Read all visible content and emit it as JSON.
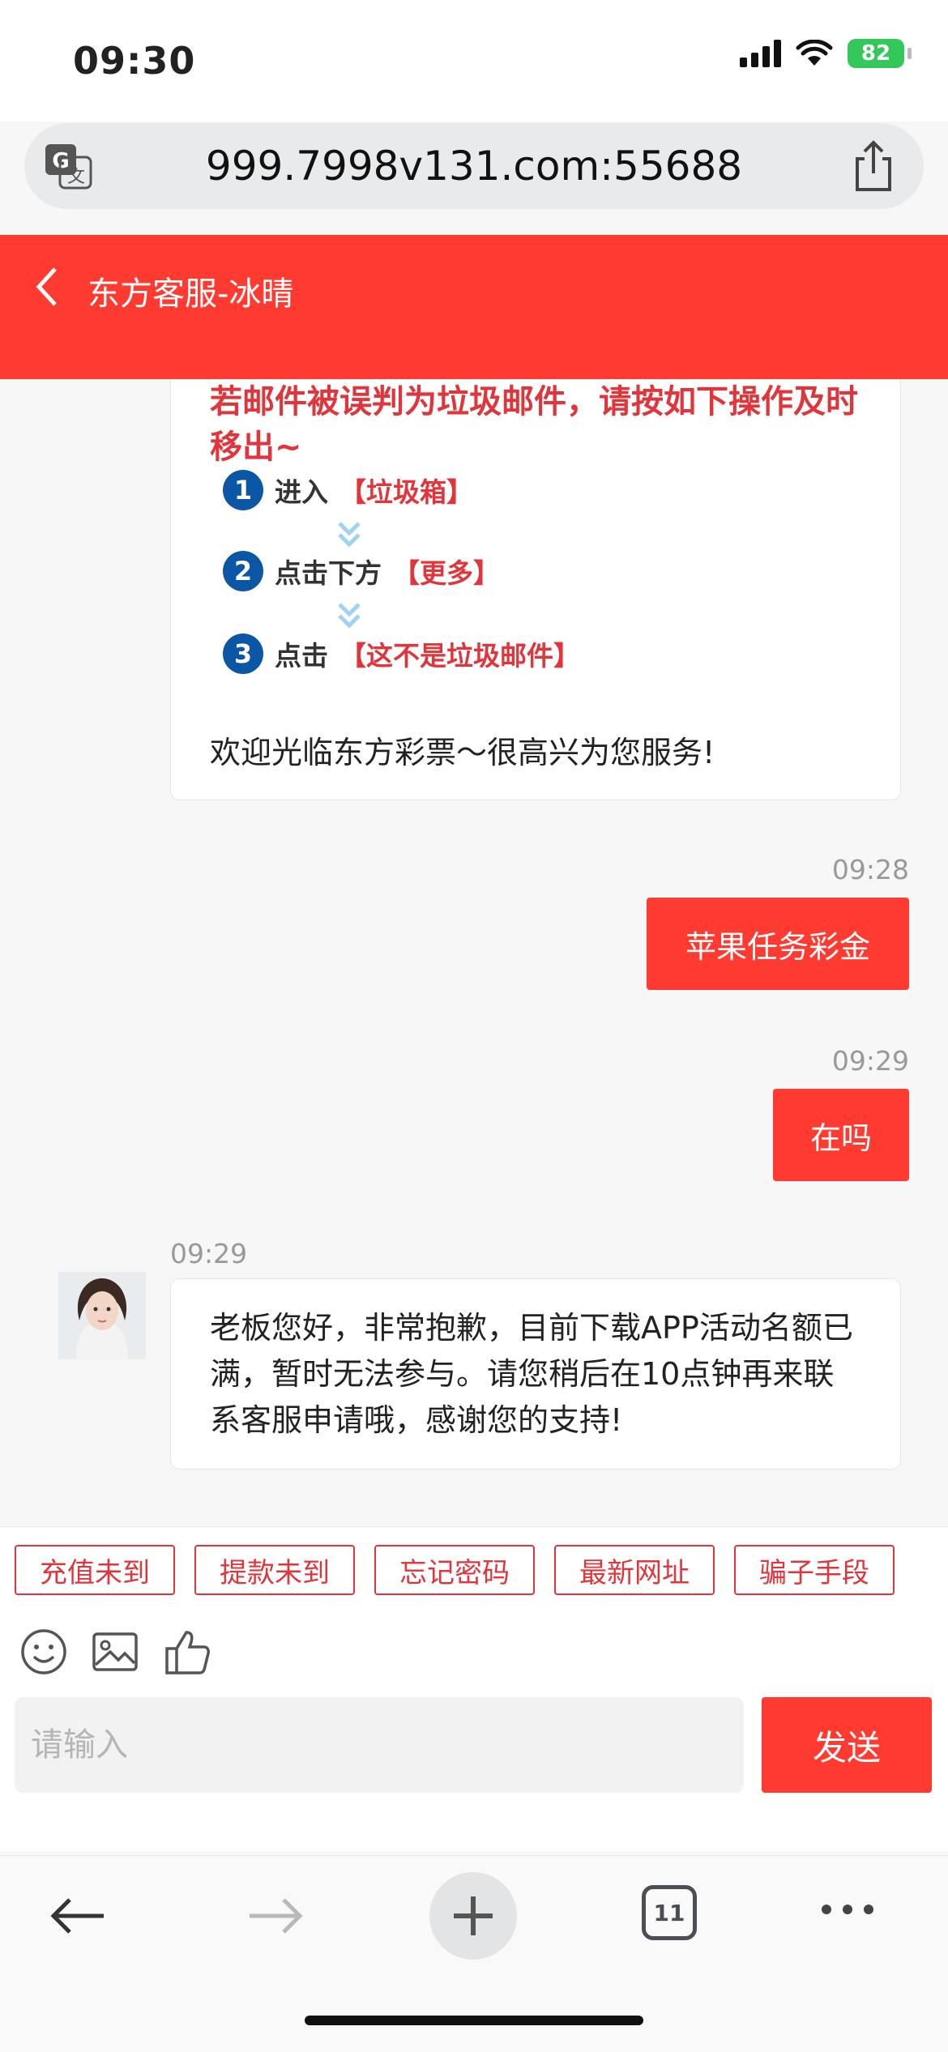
{
  "status_bar": {
    "time": "09:30",
    "battery": "82"
  },
  "browser": {
    "url": "999.7998v131.com:55688",
    "tabs_count": "11"
  },
  "header": {
    "title": "东方客服-冰晴"
  },
  "card": {
    "warning": "若邮件被误判为垃圾邮件，请按如下操作及时移出~",
    "steps": [
      {
        "num": "1",
        "prefix": "进入",
        "highlight": "【垃圾箱】"
      },
      {
        "num": "2",
        "prefix": "点击下方",
        "highlight": "【更多】"
      },
      {
        "num": "3",
        "prefix": "点击",
        "highlight": "【这不是垃圾邮件】"
      }
    ],
    "welcome": "欢迎光临东方彩票～很高兴为您服务!"
  },
  "messages": [
    {
      "time": "09:28",
      "text": "苹果任务彩金"
    },
    {
      "time": "09:29",
      "text": "在吗"
    },
    {
      "time": "09:29",
      "text": "老板您好，非常抱歉，目前下载APP活动名额已满，暂时无法参与。请您稍后在10点钟再来联系客服申请哦，感谢您的支持!"
    }
  ],
  "quick_replies": [
    "充值未到",
    "提款未到",
    "忘记密码",
    "最新网址",
    "骗子手段"
  ],
  "composer": {
    "placeholder": "请输入",
    "send_label": "发送"
  },
  "colors": {
    "accent": "#ff3a30",
    "highlight": "#e0353a",
    "step_badge": "#0b56a5"
  },
  "icons": [
    "translate-icon",
    "share-icon",
    "back-icon",
    "emoji-icon",
    "image-icon",
    "thumbs-up-icon",
    "arrow-left-icon",
    "arrow-right-icon",
    "plus-icon",
    "more-icon"
  ]
}
